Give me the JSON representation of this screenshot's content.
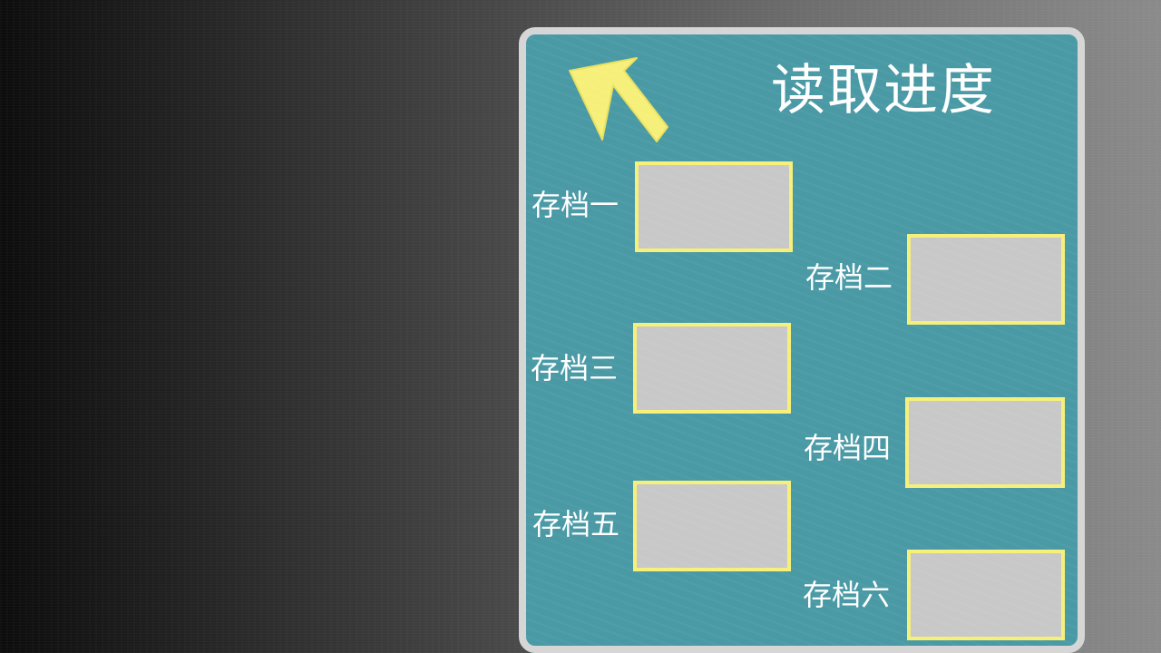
{
  "title": "读取进度",
  "back_button": {
    "icon": "back-arrow-icon",
    "color": "#f6f07a"
  },
  "slots": [
    {
      "label": "存档一"
    },
    {
      "label": "存档二"
    },
    {
      "label": "存档三"
    },
    {
      "label": "存档四"
    },
    {
      "label": "存档五"
    },
    {
      "label": "存档六"
    }
  ],
  "colors": {
    "panel": "#4a9aa6",
    "panel_border": "#d6d6d6",
    "slot_fill": "#c8c8c8",
    "slot_border": "#f6f07a"
  }
}
